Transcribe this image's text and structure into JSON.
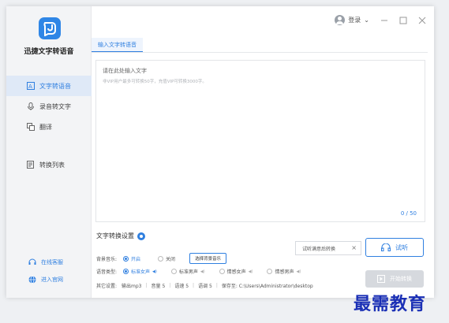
{
  "app": {
    "name": "迅捷文字转语音"
  },
  "topbar": {
    "login_label": "登录"
  },
  "sidebar": {
    "items": [
      {
        "label": "文字转语音",
        "icon": "text-icon",
        "active": true
      },
      {
        "label": "录音转文字",
        "icon": "microphone-icon",
        "active": false
      },
      {
        "label": "翻译",
        "icon": "translate-icon",
        "active": false
      },
      {
        "label": "转换列表",
        "icon": "list-icon",
        "active": false
      }
    ],
    "links": [
      {
        "label": "在线客服",
        "icon": "headset-icon"
      },
      {
        "label": "进入官网",
        "icon": "globe-icon"
      }
    ]
  },
  "tabs": [
    {
      "label": "输入文字转语音",
      "active": true
    }
  ],
  "editor": {
    "placeholder_title": "请在此处输入文字",
    "placeholder_hint": "非VIP用户最多可转换50字，充值VIP可转换3000字。",
    "count": "0 / 50"
  },
  "settings": {
    "title": "文字转换设置",
    "bgm_label": "背景音乐:",
    "bgm_on": "开启",
    "bgm_off": "关闭",
    "bgm_button": "选择背景音乐",
    "voice_label": "语音类型:",
    "voices": [
      {
        "label": "标准女声",
        "selected": true
      },
      {
        "label": "标准男声",
        "selected": false
      },
      {
        "label": "情感女声",
        "selected": false
      },
      {
        "label": "情感男声",
        "selected": false
      }
    ],
    "other_label": "其它设置:",
    "output": "输出mp3",
    "volume": "音量 5",
    "speed": "语速 5",
    "pitch": "语调 5",
    "save_to": "保存至: C:\\Users\\Administrator\\desktop"
  },
  "tooltip": {
    "text": "试听满意后转换"
  },
  "buttons": {
    "listen": "试听",
    "start": "开始转换"
  },
  "watermark": {
    "text": "最需教育"
  },
  "colors": {
    "accent": "#2f7fe0",
    "watermark": "#1a2fb5"
  }
}
